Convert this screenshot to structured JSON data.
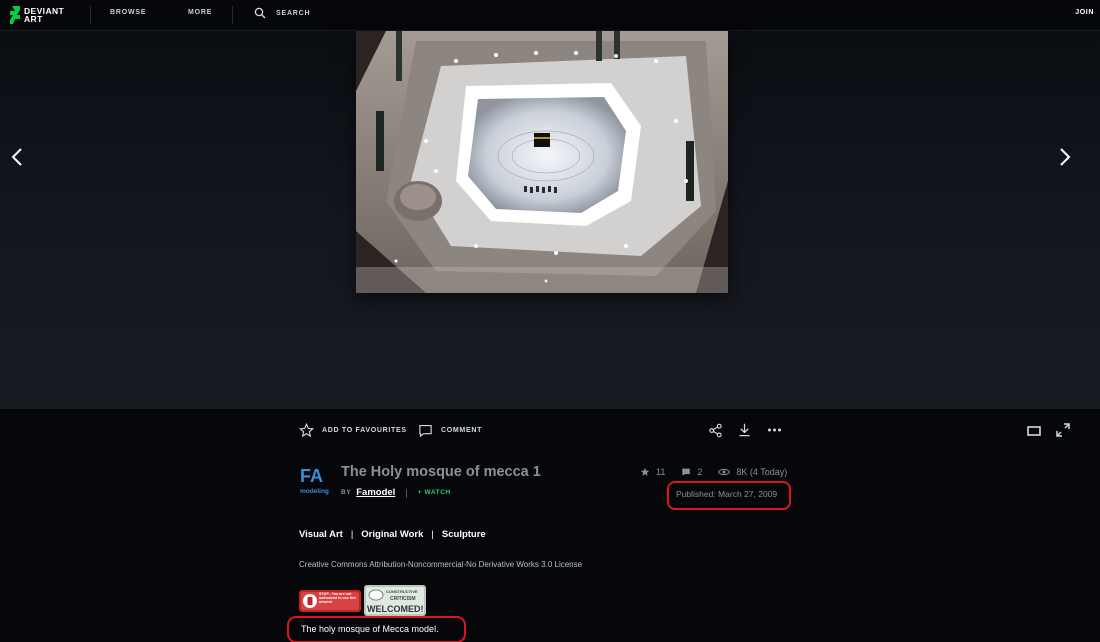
{
  "nav": {
    "logo_line1": "DEVIANT",
    "logo_line2": "ART",
    "browse": "BROWSE",
    "more": "MORE",
    "search": "SEARCH",
    "join": "JOIN"
  },
  "actions": {
    "favourite": "ADD TO FAVOURITES",
    "comment": "COMMENT"
  },
  "deviation": {
    "title": "The Holy mosque of mecca 1",
    "by": "BY",
    "author": "Famodel",
    "separator": "|",
    "watch": "+ WATCH",
    "avatar_text_big": "FA",
    "avatar_text_small": "modeling",
    "favourites": "11",
    "comments": "2",
    "views": "8K (4 Today)",
    "published": "Published: March 27, 2009",
    "categories": [
      "Visual Art",
      "Original Work",
      "Sculpture"
    ],
    "category_sep": "|",
    "license": "Creative Commons Attribution-Noncommercial-No Derivative Works 3.0 License",
    "description": "The holy mosque of Mecca model.",
    "stamp1_text": "STOP - You are not authorized to use this artwork",
    "stamp2_line1": "CONSTRUCTIVE",
    "stamp2_line2": "CRITICISM",
    "stamp2_line3": "WELCOMED!"
  },
  "colors": {
    "brand_green": "#05cc47",
    "watch_green": "#1ed27c",
    "highlight_red": "#e0141e"
  },
  "icons": [
    "deviantart-logo-icon",
    "search-icon",
    "chevron-left-icon",
    "chevron-right-icon",
    "star-icon",
    "comment-icon",
    "share-icon",
    "download-icon",
    "more-icon",
    "theater-mode-icon",
    "fullscreen-icon",
    "eye-icon"
  ]
}
